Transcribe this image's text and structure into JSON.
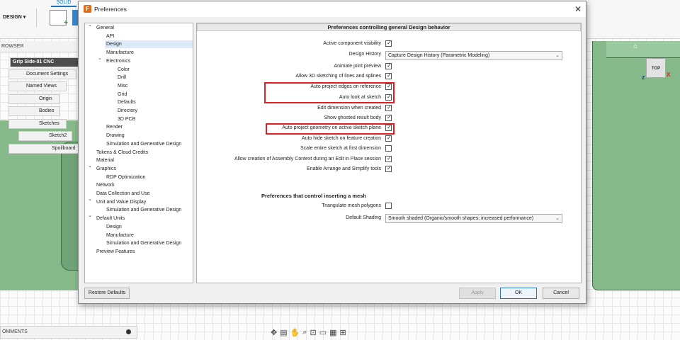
{
  "app": {
    "workspace_label": "DESIGN ▾",
    "solid_tab": "SOLID",
    "browser_title": "ROWSER",
    "comments_label": "OMMENTS",
    "viewcube_label": "TOP",
    "viewcube_axis_x": "X",
    "viewcube_axis_z": "Z",
    "browser_nodes": [
      {
        "label": "Grip Side-01 CNC"
      },
      {
        "label": "Document Settings"
      },
      {
        "label": "Named Views"
      },
      {
        "label": "Origin"
      },
      {
        "label": "Bodies"
      },
      {
        "label": "Sketches"
      },
      {
        "label": "Sketch2"
      },
      {
        "label": "Spoilboard"
      }
    ]
  },
  "dialog": {
    "title": "Preferences",
    "tree": [
      {
        "label": "General",
        "expanded": true
      },
      {
        "label": "API"
      },
      {
        "label": "Design",
        "selected": true
      },
      {
        "label": "Manufacture"
      },
      {
        "label": "Electronics",
        "expanded": true
      },
      {
        "label": "Color"
      },
      {
        "label": "Drill"
      },
      {
        "label": "Misc"
      },
      {
        "label": "Grid"
      },
      {
        "label": "Defaults"
      },
      {
        "label": "Directory"
      },
      {
        "label": "3D PCB"
      },
      {
        "label": "Render"
      },
      {
        "label": "Drawing"
      },
      {
        "label": "Simulation and Generative Design"
      },
      {
        "label": "Tokens & Cloud Credits"
      },
      {
        "label": "Material"
      },
      {
        "label": "Graphics",
        "expanded": true
      },
      {
        "label": "RDP Optimization"
      },
      {
        "label": "Network"
      },
      {
        "label": "Data Collection and Use"
      },
      {
        "label": "Unit and Value Display",
        "expanded": true
      },
      {
        "label": "Simulation and Generative Design"
      },
      {
        "label": "Default Units",
        "expanded": true
      },
      {
        "label": "Design"
      },
      {
        "label": "Manufacture"
      },
      {
        "label": "Simulation and Generative Design"
      },
      {
        "label": "Preview Features"
      }
    ],
    "panel_header": "Preferences controlling general Design behavior",
    "settings": [
      {
        "label": "Active component visibility",
        "checked": true
      },
      {
        "label": "Design History",
        "value": "Capture Design History (Parametric Modeling)"
      },
      {
        "label": "Animate joint preview",
        "checked": true
      },
      {
        "label": "Allow 3D sketching of lines and splines",
        "checked": true
      },
      {
        "label": "Auto project edges on reference",
        "checked": true
      },
      {
        "label": "Auto look at sketch",
        "checked": true
      },
      {
        "label": "Edit dimension when created",
        "checked": true
      },
      {
        "label": "Show ghosted result body",
        "checked": true
      },
      {
        "label": "Auto project geometry on active sketch plane",
        "checked": true
      },
      {
        "label": "Auto hide sketch on feature creation",
        "checked": true
      },
      {
        "label": "Scale entire sketch at first dimension",
        "checked": false
      },
      {
        "label": "Allow creation of Assembly Context during an Edit in Place session",
        "checked": true
      },
      {
        "label": "Enable Arrange and Simplify tools",
        "checked": true
      }
    ],
    "mesh_section": {
      "title": "Preferences that control inserting a mesh",
      "triangulate_label": "Triangulate mesh polygons",
      "triangulate_checked": false,
      "shading_label": "Default Shading",
      "shading_value": "Smooth shaded (Organic/smooth shapes; increased performance)"
    },
    "buttons": {
      "restore": "Restore Defaults",
      "apply": "Apply",
      "ok": "OK",
      "cancel": "Cancel"
    },
    "highlight_color": "#e02020"
  }
}
